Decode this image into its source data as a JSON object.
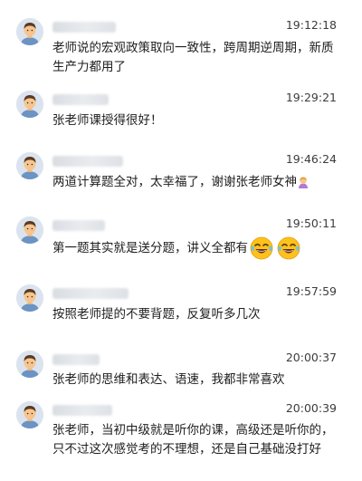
{
  "messages": [
    {
      "time": "19:12:18",
      "text": "老师说的宏观政策取向一致性，跨周期逆周期，新质生产力都用了",
      "emoji_icons": []
    },
    {
      "time": "19:29:21",
      "text": "张老师课授得很好！",
      "emoji_icons": []
    },
    {
      "time": "19:46:24",
      "text": "两道计算题全对，太幸福了，谢谢张老师女神",
      "emoji_icons": [
        "woman-bowing-icon"
      ]
    },
    {
      "time": "19:50:11",
      "text": "第一题其实就是送分题，讲义全都有",
      "emoji_icons": [
        "tears-of-joy-icon",
        "tears-of-joy-icon"
      ]
    },
    {
      "time": "19:57:59",
      "text": "按照老师提的不要背题，反复听多几次",
      "emoji_icons": []
    },
    {
      "time": "20:00:37",
      "text": "张老师的思维和表达、语速，我都非常喜欢",
      "emoji_icons": []
    },
    {
      "time": "20:00:39",
      "text": "张老师，当初中级就是听你的课，高级还是听你的，只不过这次感觉考的不理想，还是自己基础没打好",
      "emoji_icons": []
    }
  ],
  "colors": {
    "avatar_bg": "#dbe4ee",
    "skin": "#f6c58f",
    "hair": "#5a3a22",
    "shirt": "#6b93c3"
  }
}
